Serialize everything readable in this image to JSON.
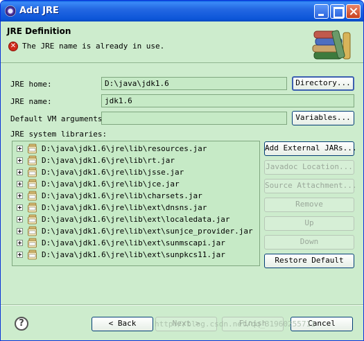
{
  "window": {
    "title": "Add JRE",
    "icon": "eclipse-icon"
  },
  "banner": {
    "title": "JRE Definition",
    "error_message": "The JRE name is already in use.",
    "error_icon": "error-icon",
    "image": "books-icon"
  },
  "form": {
    "jre_home_label": "JRE home:",
    "jre_home_value": "D:\\java\\jdk1.6",
    "directory_button": "Directory...",
    "jre_name_label": "JRE name:",
    "jre_name_value": "jdk1.6",
    "vm_args_label": "Default VM arguments:",
    "vm_args_value": "",
    "variables_button": "Variables...",
    "libraries_label": "JRE system libraries:"
  },
  "libraries": [
    "D:\\java\\jdk1.6\\jre\\lib\\resources.jar",
    "D:\\java\\jdk1.6\\jre\\lib\\rt.jar",
    "D:\\java\\jdk1.6\\jre\\lib\\jsse.jar",
    "D:\\java\\jdk1.6\\jre\\lib\\jce.jar",
    "D:\\java\\jdk1.6\\jre\\lib\\charsets.jar",
    "D:\\java\\jdk1.6\\jre\\lib\\ext\\dnsns.jar",
    "D:\\java\\jdk1.6\\jre\\lib\\ext\\localedata.jar",
    "D:\\java\\jdk1.6\\jre\\lib\\ext\\sunjce_provider.jar",
    "D:\\java\\jdk1.6\\jre\\lib\\ext\\sunmscapi.jar",
    "D:\\java\\jdk1.6\\jre\\lib\\ext\\sunpkcs11.jar"
  ],
  "library_buttons": {
    "add_external": "Add External JARs...",
    "javadoc": "Javadoc Location...",
    "source": "Source Attachment...",
    "remove": "Remove",
    "up": "Up",
    "down": "Down",
    "restore": "Restore Default"
  },
  "footer": {
    "back": "< Back",
    "next": "Next >",
    "finish": "Finish",
    "cancel": "Cancel",
    "help_icon": "help-icon",
    "watermark": "http://blog.csdn.net/qq_31960255711"
  },
  "colors": {
    "dialog_background": "#cdeccd",
    "title_bar": "#0c55d8",
    "error": "#d02a1a"
  }
}
